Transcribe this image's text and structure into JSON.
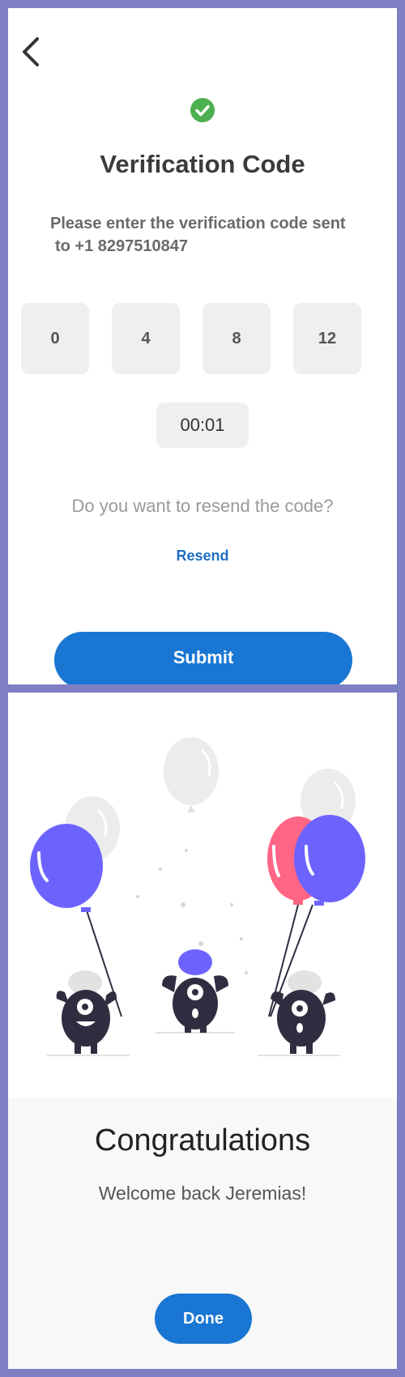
{
  "verification": {
    "title": "Verification Code",
    "instructions_line1": "Please enter the verification code sent",
    "instructions_line2": "to  +1 8297510847",
    "code_digits": [
      "0",
      "4",
      "8",
      "12"
    ],
    "timer": "00:01",
    "resend_question": "Do you want to resend the code?",
    "resend_label": "Resend",
    "submit_label": "Submit",
    "icons": {
      "back": "back-arrow-icon",
      "status": "check-circle-icon"
    }
  },
  "congratulations": {
    "title": "Congratulations",
    "message": "Welcome back Jeremias!",
    "done_label": "Done",
    "illustration": "celebrating-monsters-with-balloons"
  },
  "colors": {
    "accent": "#1976d2",
    "success": "#4caf50",
    "frame": "#7f7fc4",
    "balloon_purple": "#6c63ff",
    "balloon_pink": "#ff6584",
    "monster": "#2f2e41"
  }
}
